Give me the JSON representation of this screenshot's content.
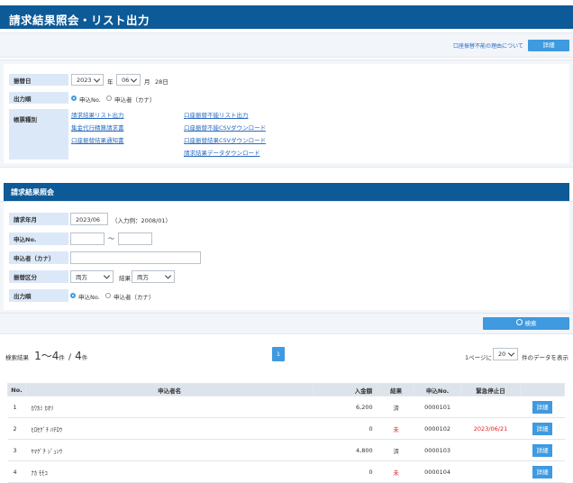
{
  "header": {
    "title": "請求結果照会・リスト出力"
  },
  "top": {
    "reason_link": "口座振替不能の理由について",
    "detail_button": "詳細"
  },
  "form1": {
    "date_label": "振替日",
    "year_value": "2023",
    "year_unit": "年",
    "month_value": "06",
    "month_unit": "月",
    "day_text": "28日",
    "order_label": "出力順",
    "order_options": [
      "申込No.",
      "申込者（カナ）"
    ],
    "form_label": "帳票種別",
    "links_left": [
      "請求結果リスト出力",
      "集金代行精算請求書",
      "口座振替結果通知書"
    ],
    "links_right": [
      "口座振替不能リスト出力",
      "口座振替不能CSVダウンロード",
      "口座振替結果CSVダウンロード",
      "請求結果データダウンロード"
    ]
  },
  "section2": {
    "title": "請求結果照会"
  },
  "form2": {
    "billing_month_label": "請求年月",
    "billing_month_value": "2023/06",
    "billing_month_hint": "（入力例：2008/01）",
    "app_no_label": "申込No.",
    "range_sep": "〜",
    "applicant_label": "申込者（カナ）",
    "transfer_label": "振替区分",
    "transfer_value": "両方",
    "result_label": "結果",
    "result_value": "両方",
    "order_label": "出力順",
    "order_options": [
      "申込No.",
      "申込者（カナ）"
    ]
  },
  "search_button": "検索",
  "results": {
    "summary_label": "検索結果",
    "range": "1〜4",
    "unit1": "件",
    "slash": "/",
    "total": "4",
    "unit2": "件",
    "page": "1",
    "per_page_prefix": "1ページに",
    "per_page_value": "20",
    "per_page_suffix": "件のデータを表示",
    "columns": [
      "No.",
      "申込者名",
      "入金額",
      "結果",
      "申込No.",
      "緊急停止日",
      ""
    ],
    "rows": [
      {
        "no": "1",
        "name": "ｶﾜｶﾐ ｶｵﾘ",
        "amount": "6,200",
        "result": "済",
        "app_no": "0000101",
        "stop_date": "",
        "btn": "詳細"
      },
      {
        "no": "2",
        "name": "ﾋﾛｾｸﾞﾁ ﾊﾁﾛｳ",
        "amount": "0",
        "result": "未",
        "app_no": "0000102",
        "stop_date": "2023/06/21",
        "btn": "詳細"
      },
      {
        "no": "3",
        "name": "ﾔﾏｸﾞﾁ ｼﾞｭﾝｳ",
        "amount": "4,800",
        "result": "済",
        "app_no": "0000103",
        "stop_date": "",
        "btn": "詳細"
      },
      {
        "no": "4",
        "name": "ﾅｶ ﾓﾓｺ",
        "amount": "0",
        "result": "未",
        "app_no": "0000104",
        "stop_date": "",
        "btn": "詳細"
      }
    ]
  },
  "colors": {
    "header": "#0d5a98",
    "button": "#3f9ae0",
    "label_bg": "#dbe8f8",
    "link": "#2a6cc0",
    "alert": "#e02020"
  }
}
